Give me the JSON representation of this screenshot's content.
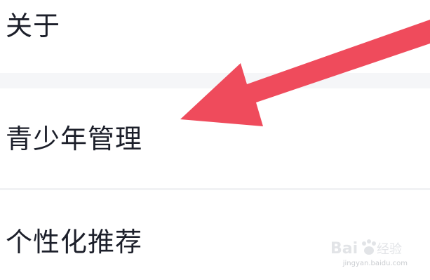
{
  "settings": {
    "items": [
      {
        "label": "关于"
      },
      {
        "label": "青少年管理"
      },
      {
        "label": "个性化推荐"
      }
    ]
  },
  "overlay": {
    "arrow_color": "#ef4b5c",
    "arrow_points_to": "青少年管理"
  },
  "watermark": {
    "logo_text": "Bai 经验",
    "url": "jingyan.baidu.com"
  }
}
